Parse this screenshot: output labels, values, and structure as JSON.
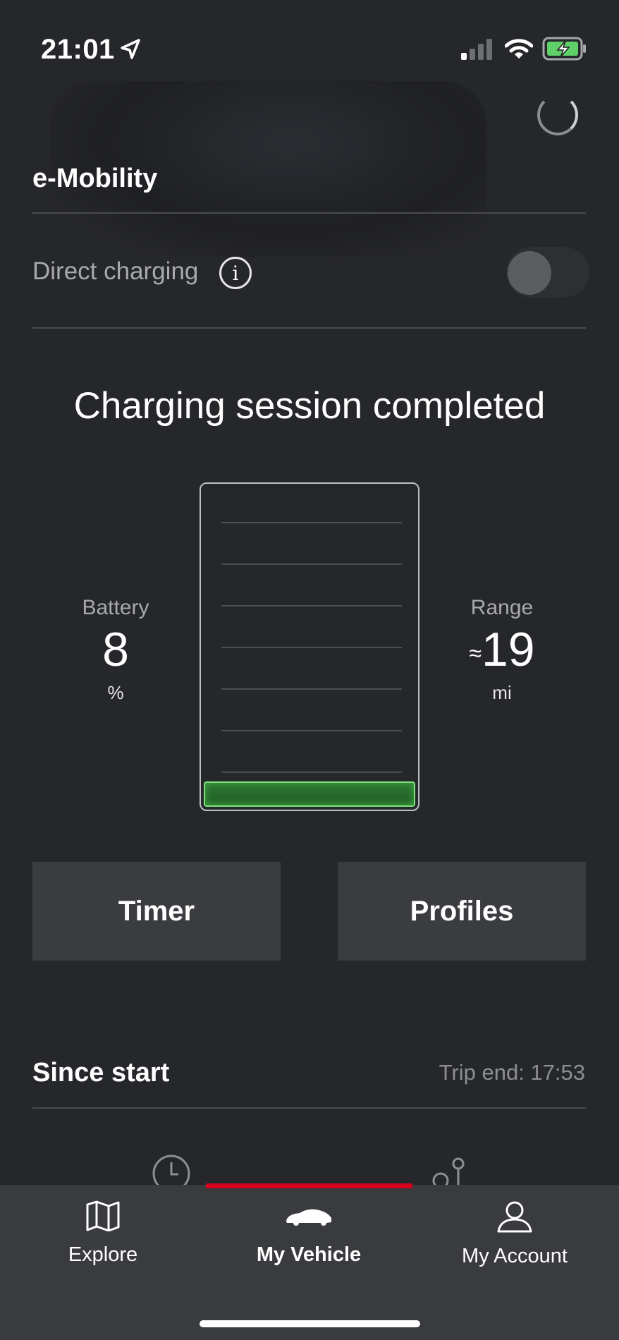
{
  "status_bar": {
    "time": "21:01",
    "icons": [
      "location-arrow-icon",
      "signal-icon",
      "wifi-icon",
      "battery-charging-icon"
    ]
  },
  "header": {
    "title": "e-Mobility"
  },
  "direct_charging": {
    "label": "Direct charging",
    "info_icon": "i",
    "enabled": false
  },
  "charging": {
    "headline": "Charging session completed",
    "battery": {
      "label": "Battery",
      "value": "8",
      "unit": "%",
      "level_fraction": 0.08
    },
    "range": {
      "label": "Range",
      "approx": "≈",
      "value": "19",
      "unit": "mi"
    },
    "fill_color": "#2f8a36"
  },
  "actions": {
    "timer_label": "Timer",
    "profiles_label": "Profiles"
  },
  "trip": {
    "title": "Since start",
    "trip_end": "Trip end: 17:53"
  },
  "tabs": [
    {
      "label": "Explore",
      "icon": "map-icon",
      "active": false
    },
    {
      "label": "My Vehicle",
      "icon": "car-icon",
      "active": true
    },
    {
      "label": "My Account",
      "icon": "person-icon",
      "active": false
    }
  ],
  "colors": {
    "accent": "#d5001c",
    "background": "#26272b",
    "tabbar": "#3a3b3f"
  }
}
